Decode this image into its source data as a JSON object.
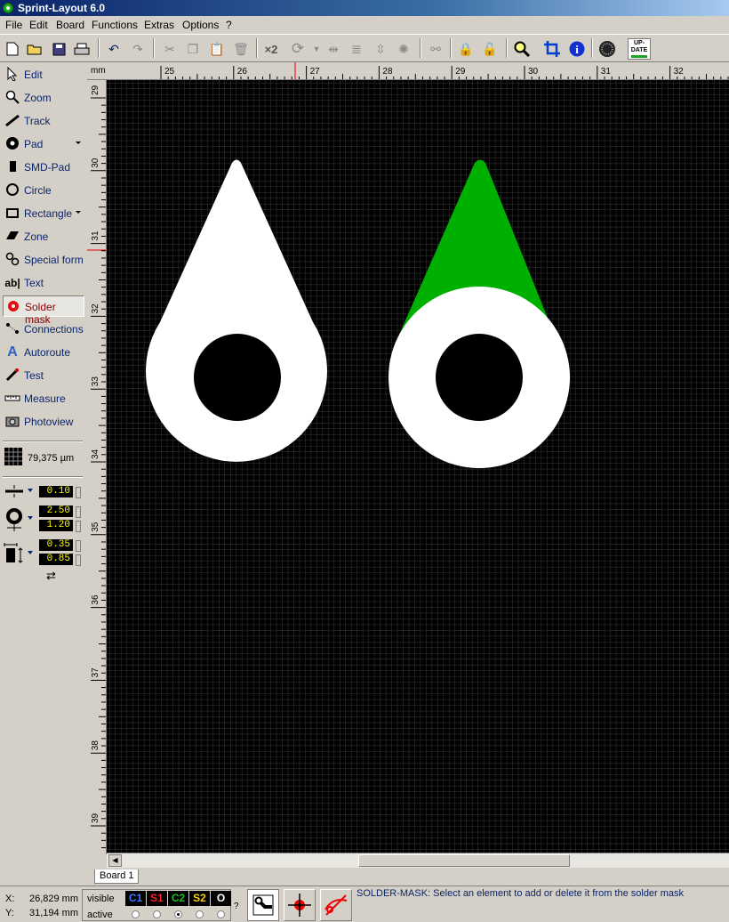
{
  "window": {
    "title": "Sprint-Layout 6.0"
  },
  "menu": [
    "File",
    "Edit",
    "Board",
    "Functions",
    "Extras",
    "Options",
    "?"
  ],
  "toolbar": {
    "x2_label": "×2",
    "update_label_1": "UP-",
    "update_label_2": "DATE"
  },
  "tools": [
    {
      "name": "edit",
      "label": "Edit"
    },
    {
      "name": "zoom",
      "label": "Zoom"
    },
    {
      "name": "track",
      "label": "Track"
    },
    {
      "name": "pad",
      "label": "Pad"
    },
    {
      "name": "smd-pad",
      "label": "SMD-Pad"
    },
    {
      "name": "circle",
      "label": "Circle"
    },
    {
      "name": "rectangle",
      "label": "Rectangle"
    },
    {
      "name": "zone",
      "label": "Zone"
    },
    {
      "name": "special-form",
      "label": "Special form"
    },
    {
      "name": "text",
      "label": "Text"
    },
    {
      "name": "solder-mask",
      "label": "Solder mask",
      "active": true
    },
    {
      "name": "connections",
      "label": "Connections"
    },
    {
      "name": "autoroute",
      "label": "Autoroute"
    },
    {
      "name": "test",
      "label": "Test"
    },
    {
      "name": "measure",
      "label": "Measure"
    },
    {
      "name": "photoview",
      "label": "Photoview"
    }
  ],
  "grid": {
    "value": "79,375 µm"
  },
  "params": {
    "track_width": "0.10",
    "pad_outer": "2.50",
    "pad_inner": "1.20",
    "smd_width": "0.35",
    "smd_height": "0.85"
  },
  "ruler": {
    "unit": "mm",
    "top": [
      "25",
      "26",
      "27",
      "28",
      "29",
      "30",
      "31",
      "32"
    ],
    "left": [
      "29",
      "30",
      "31",
      "32",
      "33",
      "34",
      "35",
      "36",
      "37",
      "38",
      "39"
    ]
  },
  "tab": {
    "label": "Board 1"
  },
  "status": {
    "x_label": "X:",
    "x_value": "26,829 mm",
    "y_label": "Y:",
    "y_value": "31,194 mm",
    "visible_label": "visible",
    "active_label": "active",
    "layers": [
      {
        "name": "C1",
        "color": "#3a7bff"
      },
      {
        "name": "S1",
        "color": "#ff2020"
      },
      {
        "name": "C2",
        "color": "#20c020"
      },
      {
        "name": "S2",
        "color": "#ffd000"
      },
      {
        "name": "O",
        "color": "#ffffff"
      }
    ],
    "active_layer_index": 2,
    "help_label": "?",
    "message": "SOLDER-MASK:  Select an element to add or delete it from the solder mask"
  },
  "colors": {
    "canvas": "#000000",
    "pad": "#ffffff",
    "drill": "#000000",
    "copper_c2": "#00b000",
    "grid": "#3a3a3a"
  }
}
